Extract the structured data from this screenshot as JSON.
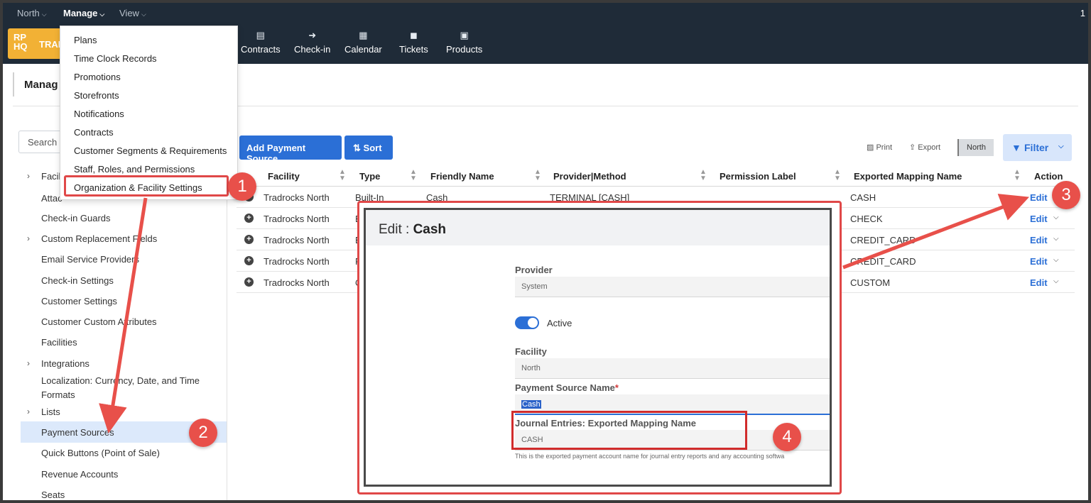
{
  "topbar": {
    "menus": [
      "North",
      "Manage",
      "View"
    ],
    "right_indicator": "1"
  },
  "logo": {
    "line1": "RP",
    "line2": "HQ",
    "brand_text": "TRAI"
  },
  "nav": [
    {
      "label": "Contracts",
      "icon": "contracts-icon"
    },
    {
      "label": "Check-in",
      "icon": "check-in-arrow-icon"
    },
    {
      "label": "Calendar",
      "icon": "calendar-icon"
    },
    {
      "label": "Tickets",
      "icon": "chat-bubble-icon"
    },
    {
      "label": "Products",
      "icon": "box-icon"
    }
  ],
  "page_title": "Manag",
  "dropdown": {
    "items": [
      "Plans",
      "Time Clock Records",
      "Promotions",
      "Storefronts",
      "Notifications",
      "Contracts",
      "Customer Segments & Requirements",
      "Staff, Roles, and Permissions",
      "Organization & Facility Settings"
    ]
  },
  "sidebar": {
    "search_placeholder": "Search (",
    "items": [
      {
        "label": "Facil",
        "chevron": true
      },
      {
        "label": "Attac",
        "chevron": false
      },
      {
        "label": "Check-in Guards",
        "chevron": false
      },
      {
        "label": "Custom Replacement Fields",
        "chevron": true
      },
      {
        "label": "Email Service Providers",
        "chevron": false
      },
      {
        "label": "Check-in Settings",
        "chevron": false
      },
      {
        "label": "Customer Settings",
        "chevron": false
      },
      {
        "label": "Customer Custom Attributes",
        "chevron": false
      },
      {
        "label": "Facilities",
        "chevron": false
      },
      {
        "label": "Integrations",
        "chevron": true
      },
      {
        "label": "Localization: Currency, Date, and Time",
        "chevron": false
      },
      {
        "label": "Formats",
        "chevron": false
      },
      {
        "label": "Lists",
        "chevron": true
      },
      {
        "label": "Payment Sources",
        "chevron": false,
        "selected": true
      },
      {
        "label": "Quick Buttons (Point of Sale)",
        "chevron": false
      },
      {
        "label": "Revenue Accounts",
        "chevron": false
      },
      {
        "label": "Seats",
        "chevron": false
      }
    ]
  },
  "toolbar": {
    "add_label": "Add Payment Source",
    "sort_label": "Sort",
    "print_label": "Print",
    "export_label": "Export",
    "north_chip": "North",
    "filter_label": "Filter"
  },
  "table": {
    "columns": [
      "Facility",
      "Type",
      "Friendly Name",
      "Provider|Method",
      "Permission Label",
      "Exported Mapping Name",
      "Action"
    ],
    "rows": [
      {
        "facility": "Tradrocks North",
        "type": "Built-In",
        "friendly": "Cash",
        "provider": "TERMINAL [CASH]",
        "mapping": "CASH",
        "action": "Edit"
      },
      {
        "facility": "Tradrocks North",
        "type": "Bu",
        "friendly": "",
        "provider": "",
        "mapping": "CHECK",
        "action": "Edit"
      },
      {
        "facility": "Tradrocks North",
        "type": "Bu",
        "friendly": "",
        "provider": "",
        "mapping": "CREDIT_CARD",
        "action": "Edit"
      },
      {
        "facility": "Tradrocks North",
        "type": "Pr",
        "friendly": "",
        "provider": "",
        "mapping": "CREDIT_CARD",
        "action": "Edit"
      },
      {
        "facility": "Tradrocks North",
        "type": "Ot",
        "friendly": "",
        "provider": "",
        "mapping": "CUSTOM",
        "action": "Edit"
      }
    ]
  },
  "modal": {
    "title_prefix": "Edit : ",
    "title_name": "Cash",
    "provider_label": "Provider",
    "provider_value": "System",
    "active_label": "Active",
    "active": true,
    "facility_label": "Facility",
    "facility_value": "North",
    "name_label": "Payment Source Name",
    "name_required": "*",
    "name_value": "Cash",
    "mapping_label": "Journal Entries: Exported Mapping Name",
    "mapping_value": "CASH",
    "help_text": "This is the exported payment account name for journal entry reports and any accounting softwa"
  },
  "annotations": [
    "1",
    "2",
    "3",
    "4"
  ],
  "colors": {
    "annotation": "#e8504a",
    "primary": "#2b6fd6",
    "nav_bg": "#1f2b38",
    "logo": "#f2b135"
  }
}
